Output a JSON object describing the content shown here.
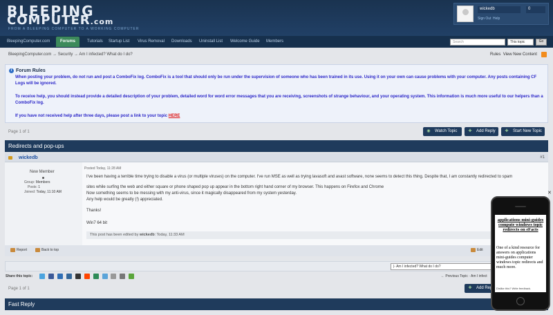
{
  "header": {
    "logo_line1": "BLEEPING",
    "logo_line2": "COMPUTER",
    "logo_suffix": ".com",
    "tagline": "FROM A BLEEPING COMPUTER TO A WORKING COMPUTER",
    "user": {
      "name": "wickedb",
      "notifications": "0",
      "sign_out": "Sign Out",
      "help": "Help"
    }
  },
  "nav": {
    "items": [
      "BleepingComputer.com",
      "Forums",
      "Tutorials",
      "Startup List",
      "Virus Removal",
      "Downloads",
      "Uninstall List",
      "Welcome Guide",
      "Members"
    ],
    "active": "Forums",
    "search_placeholder": "Search",
    "search_scope": "This topic",
    "search_button": "Go"
  },
  "breadcrumb": "BleepingComputer.com → Security → Am I infected? What do I do?",
  "top_links": {
    "rules": "Rules",
    "view_new": "View New Content"
  },
  "forum_rules": {
    "title": "Forum Rules",
    "p1": "When posting your problem, do not run and post a ComboFix log. ComboFix is a tool that should only be run under the supervision of someone who has been trained in its use. Using it on your own can cause problems with your computer. Any posts containing CF Logs will be ignored.",
    "p2": "To receive help, you should instead provide a detailed description of your problem, detailed word for word error messages that you are receiving, screenshots of strange behaviour, and your operating system. This information is much more useful to our helpers than a ComboFix log.",
    "p3": "If you have not received help after three days, please post a link to your topic",
    "p3_link": "HERE"
  },
  "pager": "Page 1 of 1",
  "buttons": {
    "watch": "Watch Topic",
    "add_reply": "Add Reply",
    "start_new": "Start New Topic"
  },
  "topic_title": "Redirects and pop-ups",
  "post": {
    "author": "wickedb",
    "number": "#1",
    "group_title": "New Member",
    "stats": [
      {
        "label": "Group:",
        "value": "Members"
      },
      {
        "label": "Posts:",
        "value": "1"
      },
      {
        "label": "Joined:",
        "value": "Today, 11:10 AM"
      }
    ],
    "posted": "Posted Today, 11:28 AM",
    "lines": [
      "I've been having a terrible time trying to disable a virus (or multiple viruses) on the computer. I've run MSE as well as trying lavasoft and avast software, none seems to detect this thing. Despite that, I am constantly redirected to spam",
      "sites while surfing the web and either square or phone shaped pop up appear in the bottom right hand corner of my browser. This happens on Firefox and Chrome",
      "Now something seems to be messing with my anti-virus, since it magically disappeared from my system yesterday.",
      "Any help would be greatly (!) appreciated.",
      "Thanks!",
      "Win7 64 bit"
    ],
    "edited_prefix": "This post has been edited by",
    "edited_by": "wickedb",
    "edited_time": ": Today, 11:33 AM",
    "report": "Report",
    "back_to_top": "Back to top",
    "edit": "Edit"
  },
  "mod_select": "|- Am I infected? What do I do?",
  "share": {
    "label": "Share this topic:"
  },
  "prev_next": {
    "prev": "← Previous Topic",
    "current": "Am I infect"
  },
  "quick_reply": "Fast Reply",
  "ad": {
    "heading": "applications mini-guides compute windows topic redirects on eFacts",
    "body": "One of a kind resource for answers on applications mini-guides computer windows topic redirects and much more.",
    "footer": "Dislike this? Write feedback."
  }
}
